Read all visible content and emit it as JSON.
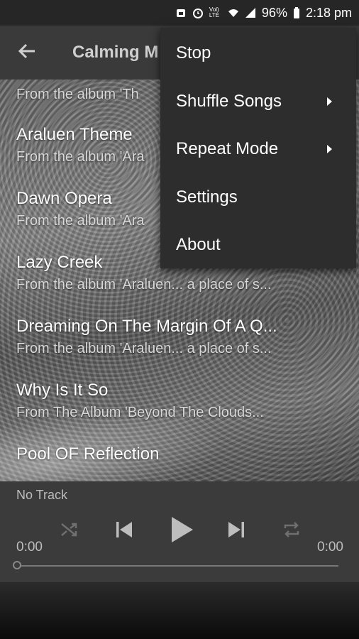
{
  "status_bar": {
    "battery": "96%",
    "time": "2:18 pm",
    "network_label": "Vol) LTE"
  },
  "app_bar": {
    "title": "Calming M"
  },
  "tracks": [
    {
      "title": "",
      "subtitle": "From the album 'Th"
    },
    {
      "title": "Araluen Theme",
      "subtitle": "From the album 'Ara"
    },
    {
      "title": "Dawn Opera",
      "subtitle": "From the album 'Ara"
    },
    {
      "title": "Lazy Creek",
      "subtitle": "From the album 'Araluen... a place of s..."
    },
    {
      "title": "Dreaming On The Margin Of A Q...",
      "subtitle": "From the album 'Araluen... a place of s..."
    },
    {
      "title": "Why Is It So",
      "subtitle": "From The Album 'Beyond The Clouds..."
    },
    {
      "title": "Pool OF Reflection",
      "subtitle": ""
    }
  ],
  "player": {
    "now_playing": "No Track",
    "time_elapsed": "0:00",
    "time_total": "0:00",
    "progress": 0
  },
  "menu": {
    "items": [
      {
        "label": "Stop",
        "has_submenu": false
      },
      {
        "label": "Shuffle Songs",
        "has_submenu": true
      },
      {
        "label": "Repeat Mode",
        "has_submenu": true
      },
      {
        "label": "Settings",
        "has_submenu": false
      },
      {
        "label": "About",
        "has_submenu": false
      }
    ]
  },
  "icons": {
    "back": "arrow-left-icon",
    "shuffle": "shuffle-icon",
    "previous": "skip-previous-icon",
    "play": "play-icon",
    "next": "skip-next-icon",
    "repeat": "repeat-icon"
  },
  "colors": {
    "app_bar": "#3a3a3a",
    "menu": "#2d2d2d",
    "player": "#3b3b3b",
    "text": "#ffffff",
    "muted_text": "#bdbdbd"
  }
}
